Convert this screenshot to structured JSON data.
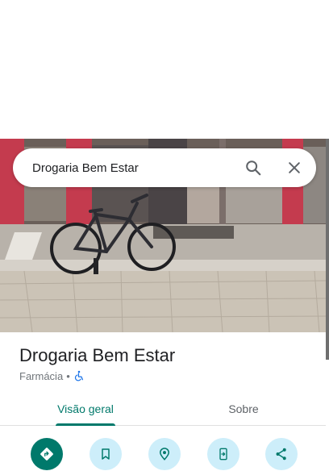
{
  "search": {
    "value": "Drogaria Bem Estar",
    "search_icon": "search-icon",
    "close_icon": "close-icon"
  },
  "place": {
    "name": "Drogaria Bem Estar",
    "category": "Farmácia",
    "separator": "•",
    "accessibility_icon": "wheelchair-accessible-icon"
  },
  "tabs": [
    {
      "label": "Visão geral",
      "active": true
    },
    {
      "label": "Sobre",
      "active": false
    }
  ],
  "actions": [
    {
      "icon": "directions-icon"
    },
    {
      "icon": "bookmark-icon"
    },
    {
      "icon": "nearby-icon"
    },
    {
      "icon": "send-to-phone-icon"
    },
    {
      "icon": "share-icon"
    }
  ],
  "colors": {
    "accent": "#00796b",
    "action_secondary_bg": "#cdeefa",
    "accessibility_blue": "#1a73e8"
  }
}
